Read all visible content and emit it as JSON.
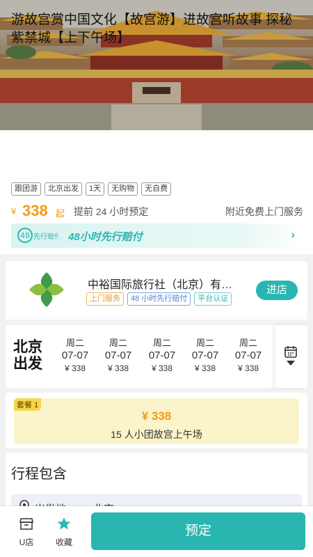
{
  "product": {
    "title": "游故宫赏中国文化【故宫游】进故宫听故事 探秘紫禁城【上下午场】",
    "tags": [
      "跟团游",
      "北京出发",
      "1天",
      "无购物",
      "无自费"
    ],
    "price_symbol": "¥",
    "price": "338",
    "price_suffix": "起",
    "advance_booking": "提前 24 小时预定",
    "nearby_service": "附近免费上门服务",
    "banner_text": "48小时先行赔付",
    "banner_logo_text": "先行赔付"
  },
  "shop": {
    "name": "中裕国际旅行社（北京）有…",
    "tags": [
      "上门服务",
      "48 小时先行赔付",
      "平台认证"
    ],
    "enter_label": "进店"
  },
  "dates": {
    "depart_label": "北京出发",
    "items": [
      {
        "weekday": "周二",
        "date": "07-07",
        "price": "¥ 338"
      },
      {
        "weekday": "周二",
        "date": "07-07",
        "price": "¥ 338"
      },
      {
        "weekday": "周二",
        "date": "07-07",
        "price": "¥ 338"
      },
      {
        "weekday": "周二",
        "date": "07-07",
        "price": "¥ 338"
      },
      {
        "weekday": "周二",
        "date": "07-07",
        "price": "¥ 338"
      }
    ]
  },
  "package": {
    "badge": "套餐 1",
    "price": "¥ 338",
    "name": "15 人小团故宫上午场"
  },
  "itinerary": {
    "title": "行程包含",
    "depart_label": "出发地",
    "depart_value": "北京"
  },
  "bottom_bar": {
    "shop_label": "U店",
    "fav_label": "收藏",
    "book_label": "预定"
  },
  "colors": {
    "accent": "#2ab6b0",
    "price": "#f59a12",
    "package_bg": "#fbf3c9"
  }
}
